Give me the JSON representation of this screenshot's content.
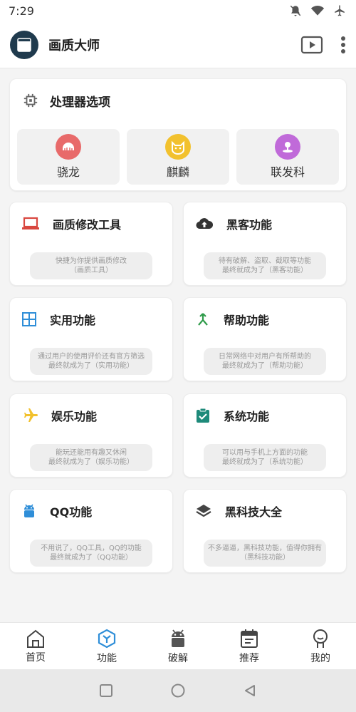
{
  "status_bar": {
    "time": "7:29"
  },
  "app_bar": {
    "title": "画质大师"
  },
  "processor": {
    "title": "处理器选项",
    "items": [
      {
        "label": "骁龙",
        "color": "#e86a6a"
      },
      {
        "label": "麒麟",
        "color": "#f2c12e"
      },
      {
        "label": "联发科",
        "color": "#c06ad9"
      }
    ]
  },
  "features": [
    {
      "title": "画质修改工具",
      "desc1": "快捷为你提供画质修改",
      "desc2": "（画质工具）",
      "icon": "laptop-icon",
      "color": "#d9473f"
    },
    {
      "title": "黑客功能",
      "desc1": "待有破解、盗取、截取等功能",
      "desc2": "最终就成为了（黑客功能）",
      "icon": "cloud-upload-icon",
      "color": "#333333"
    },
    {
      "title": "实用功能",
      "desc1": "通过用户的使用评价还有官方筛选",
      "desc2": "最终就成为了（实用功能）",
      "icon": "grid-icon",
      "color": "#2f8ed8"
    },
    {
      "title": "帮助功能",
      "desc1": "日常网络中对用户有所帮助的",
      "desc2": "最终就成为了（帮助功能）",
      "icon": "merge-arrow-icon",
      "color": "#2f9b4a"
    },
    {
      "title": "娱乐功能",
      "desc1": "能玩还能用有趣又休闲",
      "desc2": "最终就成为了（娱乐功能）",
      "icon": "airplane-icon",
      "color": "#f2c12e"
    },
    {
      "title": "系统功能",
      "desc1": "可以用与手机上方面的功能",
      "desc2": "最终就成为了（系统功能）",
      "icon": "clipboard-check-icon",
      "color": "#1e8a7a"
    },
    {
      "title": "QQ功能",
      "desc1": "不用说了，QQ工具，QQ的功能",
      "desc2": "最终就成为了（QQ功能）",
      "icon": "android-icon",
      "color": "#2f8ed8"
    },
    {
      "title": "黑科技大全",
      "desc1": "不多逼逼，黑科技功能，值得你拥有",
      "desc2": "（黑科技功能）",
      "icon": "layers-icon",
      "color": "#444444"
    }
  ],
  "bottom_nav": [
    {
      "label": "首页",
      "icon": "home-icon",
      "active": false
    },
    {
      "label": "功能",
      "icon": "cube-icon",
      "active": true
    },
    {
      "label": "破解",
      "icon": "android-icon",
      "active": false
    },
    {
      "label": "推荐",
      "icon": "calendar-icon",
      "active": false
    },
    {
      "label": "我的",
      "icon": "person-icon",
      "active": false
    }
  ],
  "colors": {
    "accent": "#2f8ed8",
    "logo_bg": "#1f3a4d"
  }
}
